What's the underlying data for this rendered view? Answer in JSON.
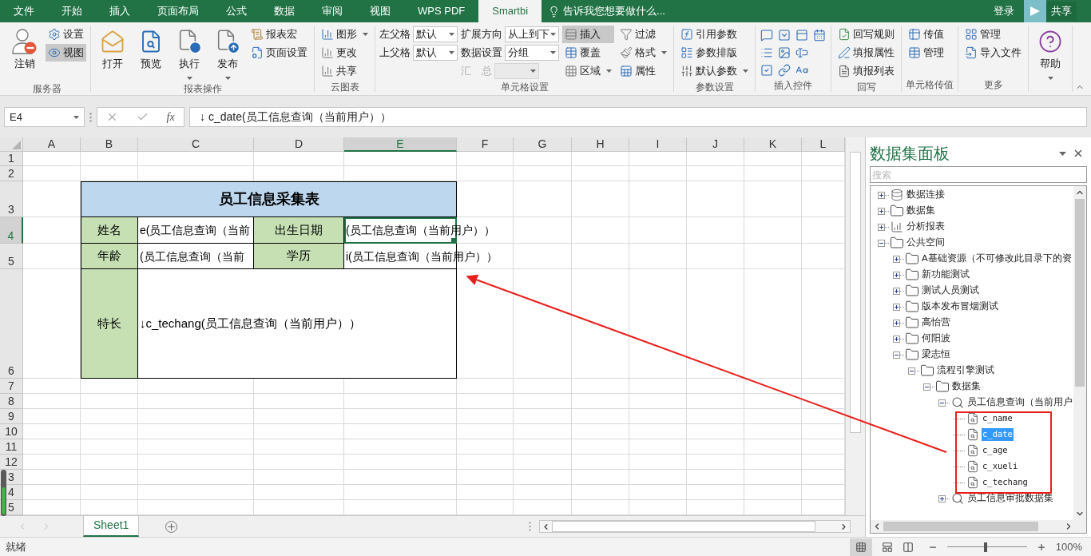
{
  "tabs": [
    {
      "label": "文件",
      "selected": false
    },
    {
      "label": "开始",
      "selected": false
    },
    {
      "label": "插入",
      "selected": false
    },
    {
      "label": "页面布局",
      "selected": false
    },
    {
      "label": "公式",
      "selected": false
    },
    {
      "label": "数据",
      "selected": false
    },
    {
      "label": "审阅",
      "selected": false
    },
    {
      "label": "视图",
      "selected": false
    },
    {
      "label": "WPS PDF",
      "selected": false
    },
    {
      "label": "Smartbi",
      "selected": true
    }
  ],
  "tell_me": {
    "placeholder": "告诉我您想要做什么..."
  },
  "account": {
    "sign_in": "登录",
    "share": "共享"
  },
  "ribbon": {
    "groups": [
      {
        "kind": "buttons",
        "label": "服务器",
        "columns": [
          [
            {
              "kind": "large",
              "label": "注销",
              "caret": false,
              "on": false
            }
          ],
          [
            {
              "kind": "small",
              "label": "设置",
              "caret": false,
              "on": false
            },
            {
              "kind": "small",
              "label": "视图",
              "caret": false,
              "on": true
            }
          ]
        ]
      },
      {
        "kind": "buttons",
        "label": "报表操作",
        "columns": [
          [
            {
              "kind": "large",
              "label": "打开",
              "caret": false,
              "on": false
            }
          ],
          [
            {
              "kind": "large",
              "label": "预览",
              "caret": false,
              "on": false
            }
          ],
          [
            {
              "kind": "large",
              "label": "执行",
              "caret": true,
              "on": false
            }
          ],
          [
            {
              "kind": "large",
              "label": "发布",
              "caret": true,
              "on": false
            }
          ],
          [
            {
              "kind": "small",
              "label": "报表宏",
              "caret": false,
              "on": false
            },
            {
              "kind": "small",
              "label": "页面设置",
              "caret": false,
              "on": false
            }
          ]
        ]
      },
      {
        "kind": "buttons",
        "label": "云图表",
        "columns": [
          [
            {
              "kind": "small",
              "label": "图形",
              "caret": true,
              "on": false
            },
            {
              "kind": "small",
              "label": "更改",
              "caret": false,
              "on": false
            },
            {
              "kind": "small",
              "label": "共享",
              "caret": false,
              "on": false
            }
          ]
        ]
      },
      {
        "kind": "buttons",
        "label": "单元格设置",
        "columns": [
          [
            {
              "kind": "field",
              "label": "左父格",
              "value": "默认",
              "disabled": false
            },
            {
              "kind": "field",
              "label": "上父格",
              "value": "默认",
              "disabled": false
            }
          ],
          [
            {
              "kind": "field",
              "label": "扩展方向",
              "value": "从上到下",
              "disabled": false
            },
            {
              "kind": "field",
              "label": "数据设置",
              "value": "分组",
              "disabled": false
            },
            {
              "kind": "field",
              "label": "汇　总",
              "disabled": true
            }
          ],
          [
            {
              "kind": "small",
              "label": "插入",
              "caret": false,
              "on": true
            },
            {
              "kind": "small",
              "label": "覆盖",
              "caret": false,
              "on": false
            },
            {
              "kind": "small",
              "label": "区域",
              "caret": true,
              "on": false
            }
          ],
          [
            {
              "kind": "small",
              "label": "过滤",
              "caret": false,
              "on": false
            },
            {
              "kind": "small",
              "label": "格式",
              "caret": true,
              "on": false
            },
            {
              "kind": "small",
              "label": "属性",
              "caret": false,
              "on": false
            }
          ]
        ]
      },
      {
        "kind": "buttons",
        "label": "参数设置",
        "columns": [
          [
            {
              "kind": "small",
              "label": "引用参数",
              "caret": false,
              "on": false
            },
            {
              "kind": "small",
              "label": "参数排版",
              "caret": false,
              "on": false
            },
            {
              "kind": "small",
              "label": "默认参数",
              "caret": true,
              "on": false
            }
          ]
        ]
      },
      {
        "kind": "controls",
        "label": "插入控件"
      },
      {
        "kind": "buttons",
        "label": "回写",
        "columns": [
          [
            {
              "kind": "small",
              "label": "回写规则",
              "caret": false,
              "on": false
            },
            {
              "kind": "small",
              "label": "填报属性",
              "caret": false,
              "on": false
            },
            {
              "kind": "small",
              "label": "填报列表",
              "caret": false,
              "on": false
            }
          ]
        ]
      },
      {
        "kind": "buttons",
        "label": "单元格传值",
        "columns": [
          [
            {
              "kind": "small",
              "label": "传值",
              "caret": false,
              "on": false
            },
            {
              "kind": "small",
              "label": "管理",
              "caret": false,
              "on": false
            }
          ]
        ]
      },
      {
        "kind": "buttons",
        "label": "更多",
        "columns": [
          [
            {
              "kind": "small",
              "label": "管理",
              "caret": false,
              "on": false
            },
            {
              "kind": "small",
              "label": "导入文件",
              "caret": false,
              "on": false
            }
          ]
        ]
      },
      {
        "kind": "buttons",
        "columns": [
          [
            {
              "kind": "large",
              "label": "帮助",
              "caret": true,
              "on": false
            }
          ]
        ]
      }
    ]
  },
  "formula_bar": {
    "name_box": "E4",
    "function_button": "fx",
    "formula": "↓ c_date(员工信息查询（当前用户））"
  },
  "sheet": {
    "columns": [
      {
        "label": "A",
        "selected": false
      },
      {
        "label": "B",
        "selected": false
      },
      {
        "label": "C",
        "selected": false
      },
      {
        "label": "D",
        "selected": false
      },
      {
        "label": "E",
        "selected": true
      },
      {
        "label": "F",
        "selected": false
      },
      {
        "label": "G",
        "selected": false
      },
      {
        "label": "H",
        "selected": false
      },
      {
        "label": "I",
        "selected": false
      },
      {
        "label": "J",
        "selected": false
      },
      {
        "label": "K",
        "selected": false
      },
      {
        "label": "L",
        "selected": false
      }
    ],
    "rows": [
      {
        "label": "1",
        "selected": false
      },
      {
        "label": "2",
        "selected": false
      },
      {
        "label": "3",
        "selected": false
      },
      {
        "label": "4",
        "selected": true
      },
      {
        "label": "5",
        "selected": false
      },
      {
        "label": "6",
        "selected": false
      },
      {
        "label": "7",
        "selected": false
      },
      {
        "label": "8",
        "selected": false
      },
      {
        "label": "9",
        "selected": false
      },
      {
        "label": "10",
        "selected": false
      },
      {
        "label": "11",
        "selected": false
      },
      {
        "label": "12",
        "selected": false
      },
      {
        "label": "3",
        "selected": false
      },
      {
        "label": "4",
        "selected": false
      },
      {
        "label": "5",
        "selected": false
      }
    ],
    "form": {
      "title": "员工信息采集表",
      "fields": [
        {
          "label": "姓名",
          "value": "e(员工信息查询（当前",
          "selected": false
        },
        {
          "label": "出生日期",
          "value": "(员工信息查询（当前用户））",
          "selected": true
        },
        {
          "label": "年龄",
          "value": "(员工信息查询（当前",
          "selected": false
        },
        {
          "label": "学历",
          "value": "i(员工信息查询（当前用户））",
          "selected": false
        }
      ],
      "remark": {
        "label": "特长",
        "value": "↓c_techang(员工信息查询（当前用户））"
      }
    }
  },
  "sheets": [
    {
      "label": "Sheet1",
      "selected": true
    }
  ],
  "panel": {
    "title": "数据集面板",
    "search": {
      "placeholder": "搜索"
    },
    "tree": [
      {
        "kind": "connection",
        "label": "数据连接",
        "expanded": false,
        "selected": false
      },
      {
        "kind": "folder",
        "label": "数据集",
        "expanded": false,
        "selected": false
      },
      {
        "kind": "report",
        "label": "分析报表",
        "expanded": false,
        "selected": false
      },
      {
        "kind": "folder",
        "label": "公共空间",
        "expanded": true,
        "selected": false,
        "children": [
          {
            "kind": "folder",
            "label": "A基础资源（不可修改此目录下的资",
            "expanded": false,
            "selected": false
          },
          {
            "kind": "folder",
            "label": "新功能测试",
            "expanded": false,
            "selected": false
          },
          {
            "kind": "folder",
            "label": "测试人员测试",
            "expanded": false,
            "selected": false
          },
          {
            "kind": "folder",
            "label": "版本发布冒烟测试",
            "expanded": false,
            "selected": false
          },
          {
            "kind": "folder",
            "label": "高怡营",
            "expanded": false,
            "selected": false
          },
          {
            "kind": "folder",
            "label": "何阳波",
            "expanded": false,
            "selected": false
          },
          {
            "kind": "folder",
            "label": "梁志恒",
            "expanded": true,
            "selected": false,
            "children": [
              {
                "kind": "folder",
                "label": "流程引擎测试",
                "expanded": true,
                "selected": false,
                "children": [
                  {
                    "kind": "folder",
                    "label": "数据集",
                    "expanded": true,
                    "selected": false,
                    "children": [
                      {
                        "kind": "dataset",
                        "label": "员工信息查询（当前用户",
                        "expanded": true,
                        "selected": false,
                        "children": [
                          {
                            "kind": "field",
                            "label": "c_name",
                            "selected": false
                          },
                          {
                            "kind": "field",
                            "label": "c_date",
                            "selected": true
                          },
                          {
                            "kind": "field",
                            "label": "c_age",
                            "selected": false
                          },
                          {
                            "kind": "field",
                            "label": "c_xueli",
                            "selected": false
                          },
                          {
                            "kind": "field",
                            "label": "c_techang",
                            "selected": false
                          }
                        ]
                      },
                      {
                        "kind": "dataset",
                        "label": "员工信息审批数据集",
                        "expanded": false,
                        "selected": false
                      }
                    ]
                  }
                ]
              }
            ]
          }
        ]
      }
    ]
  },
  "status_bar": {
    "status": "就绪",
    "zoom_slider": {
      "level": 0.48
    },
    "zoom": "100%"
  }
}
